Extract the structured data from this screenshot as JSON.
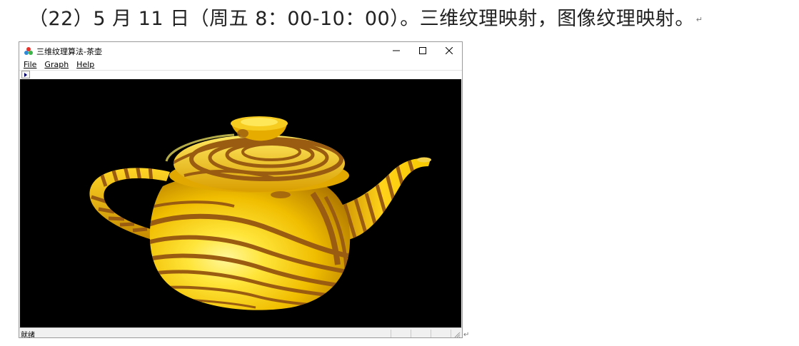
{
  "document": {
    "heading": "（22）5 月 11 日（周五 8：00-10：00）。三维纹理映射，图像纹理映射。",
    "paragraph_mark": "↵"
  },
  "window": {
    "title": "三维纹理算法-茶壶",
    "controls": {
      "minimize": "—",
      "maximize": "☐",
      "close": "✕"
    }
  },
  "menu": {
    "items": [
      "File",
      "Graph",
      "Help"
    ]
  },
  "statusbar": {
    "text": "就绪"
  },
  "colors": {
    "canvas_background": "#000000",
    "teapot_gold": "#f2c200",
    "teapot_highlight": "#fff36a",
    "teapot_shadow": "#b07800",
    "stripe_brown": "#9a5c10"
  },
  "icons": {
    "app": "colored-balls-icon",
    "toolbar_play": "play-arrow-icon",
    "resize": "resize-grip-icon"
  }
}
